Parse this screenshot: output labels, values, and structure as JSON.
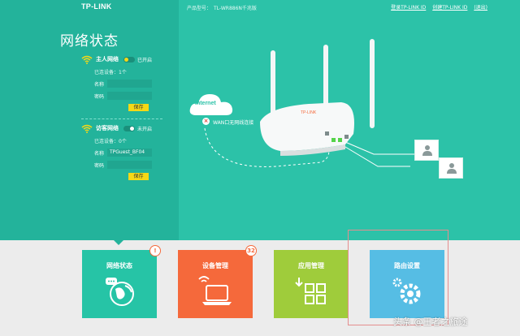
{
  "header": {
    "logo": "TP-LINK",
    "model_label": "产品型号：",
    "model_value": "TL-WR886N千兆版",
    "link_login": "登录TP-LINK ID",
    "link_create": "创建TP-LINK ID",
    "link_exit": "(退出)"
  },
  "panel": {
    "title": "网络状态",
    "main_network": {
      "name": "主人网络",
      "status": "已开启",
      "devices": "已连设备：1个",
      "name_label": "名称",
      "name_value": "",
      "password_label": "密码",
      "password_value": "",
      "save": "保存"
    },
    "guest_network": {
      "name": "访客网络",
      "status": "未开启",
      "devices": "已连设备：0个",
      "name_label": "名称",
      "name_value": "TPGuest_BF04",
      "password_label": "密码",
      "password_value": "",
      "save": "保存"
    }
  },
  "diagram": {
    "internet_label": "Internet",
    "wan_status": "WAN口无网线连接",
    "router_brand": "TP-LINK"
  },
  "tiles": [
    {
      "label": "网络状态",
      "icon": "globe-chat-icon",
      "badge": "!"
    },
    {
      "label": "设备管理",
      "icon": "laptop-wifi-icon",
      "badge": "32"
    },
    {
      "label": "应用管理",
      "icon": "grid-apps-icon",
      "badge": ""
    },
    {
      "label": "路由设置",
      "icon": "gears-icon",
      "badge": ""
    }
  ],
  "watermark": "头条 @王者之旅途",
  "colors": {
    "teal": "#2cc2a8",
    "teal_dark": "#23b39b",
    "orange": "#f5693b",
    "green": "#9fcc3b",
    "blue": "#56bde4",
    "yellow": "#f5d817"
  }
}
